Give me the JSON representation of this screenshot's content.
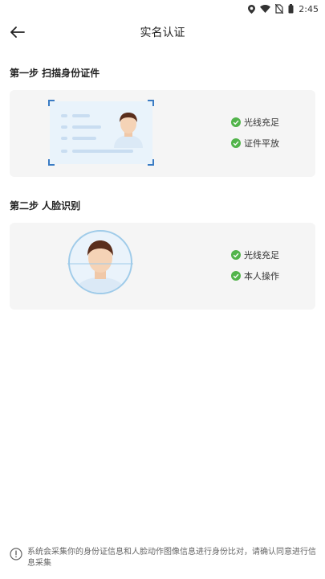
{
  "status_bar": {
    "time": "2:45"
  },
  "header": {
    "title": "实名认证"
  },
  "step1": {
    "title": "第一步 扫描身份证件",
    "checks": [
      "光线充足",
      "证件平放"
    ]
  },
  "step2": {
    "title": "第二步 人脸识别",
    "checks": [
      "光线充足",
      "本人操作"
    ]
  },
  "footer": {
    "notice": "系统会采集你的身份证信息和人脸动作图像信息进行身份比对，请确认同意进行信息采集"
  },
  "colors": {
    "check_green": "#52b44b",
    "frame_blue": "#3a7cc4",
    "card_bg": "#f5f5f5"
  }
}
